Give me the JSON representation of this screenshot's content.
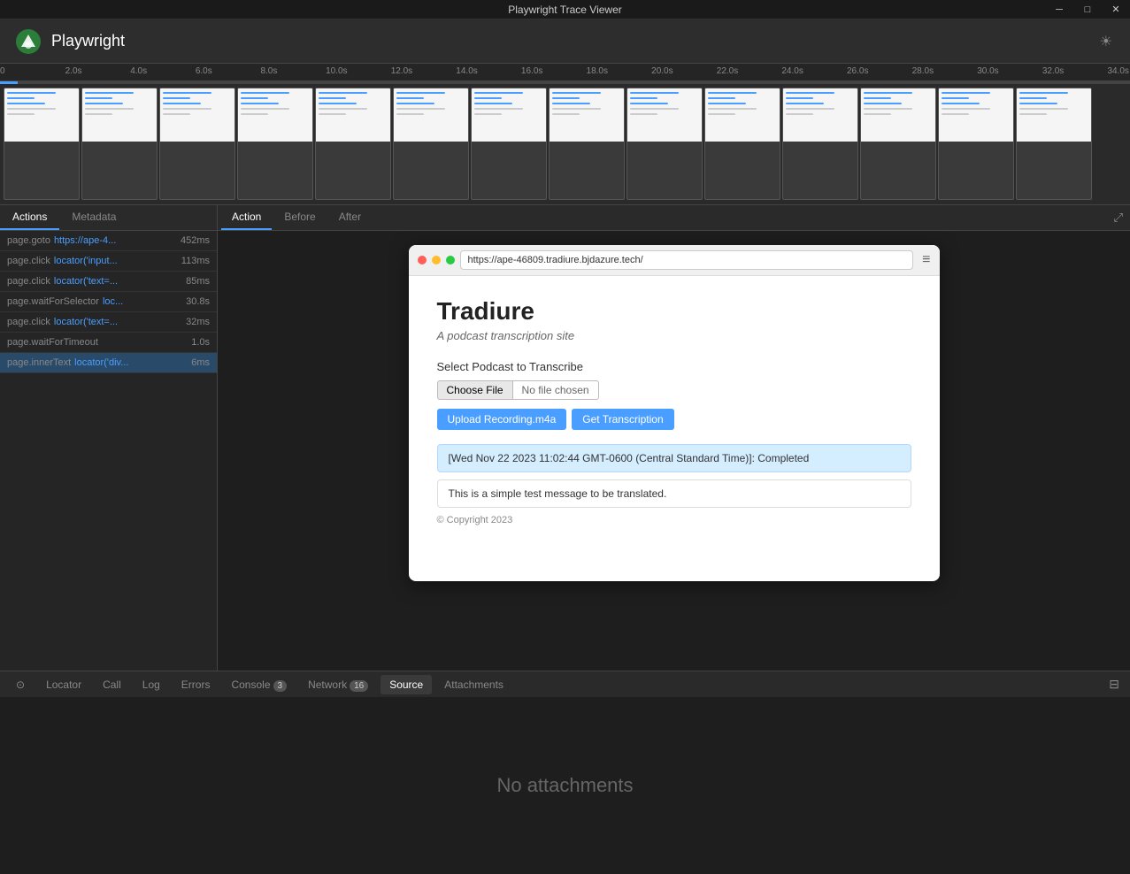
{
  "titleBar": {
    "title": "Playwright Trace Viewer",
    "controls": [
      "minimize",
      "maximize",
      "close"
    ]
  },
  "header": {
    "appTitle": "Playwright",
    "themeIcon": "☀"
  },
  "timeline": {
    "ticks": [
      "0",
      "2.0s",
      "4.0s",
      "6.0s",
      "8.0s",
      "10.0s",
      "12.0s",
      "14.0s",
      "16.0s",
      "18.0s",
      "20.0s",
      "22.0s",
      "24.0s",
      "26.0s",
      "28.0s",
      "30.0s",
      "32.0s",
      "34.0s"
    ]
  },
  "leftPanel": {
    "tabs": [
      {
        "label": "Actions",
        "active": true
      },
      {
        "label": "Metadata",
        "active": false
      }
    ],
    "actions": [
      {
        "method": "page.goto",
        "locator": "https://ape-4...",
        "duration": "452ms",
        "active": false
      },
      {
        "method": "page.click",
        "locator": "locator('input...",
        "duration": "113ms",
        "active": false
      },
      {
        "method": "page.click",
        "locator": "locator('text=...",
        "duration": "85ms",
        "active": false
      },
      {
        "method": "page.waitForSelector",
        "locator": "loc...",
        "duration": "30.8s",
        "active": false
      },
      {
        "method": "page.click",
        "locator": "locator('text=...",
        "duration": "32ms",
        "active": false
      },
      {
        "method": "page.waitForTimeout",
        "locator": "",
        "duration": "1.0s",
        "active": false
      },
      {
        "method": "page.innerText",
        "locator": "locator('div...",
        "duration": "6ms",
        "active": true
      }
    ]
  },
  "rightPanel": {
    "tabs": [
      {
        "label": "Action",
        "active": true
      },
      {
        "label": "Before",
        "active": false
      },
      {
        "label": "After",
        "active": false
      }
    ],
    "expandIcon": "⤢",
    "browser": {
      "url": "https://ape-46809.tradiure.bjdazure.tech/",
      "site": {
        "title": "Tradiure",
        "subtitle": "A podcast transcription site",
        "selectLabel": "Select Podcast to Transcribe",
        "chooseFileBtn": "Choose File",
        "noFileText": "No file chosen",
        "uploadBtn": "Upload Recording.m4a",
        "transcribeBtn": "Get Transcription",
        "statusMessage": "[Wed Nov 22 2023 11:02:44 GMT-0600 (Central Standard Time)]: Completed",
        "resultMessage": "This is a simple test message to be translated.",
        "copyright": "© Copyright 2023"
      }
    }
  },
  "bottomBar": {
    "tabs": [
      {
        "label": "⊙",
        "type": "icon",
        "active": false
      },
      {
        "label": "Locator",
        "active": false
      },
      {
        "label": "Call",
        "active": false
      },
      {
        "label": "Log",
        "active": false
      },
      {
        "label": "Errors",
        "active": false
      },
      {
        "label": "Console",
        "active": false,
        "badge": "3"
      },
      {
        "label": "Network",
        "active": false,
        "badge": "16"
      },
      {
        "label": "Source",
        "active": true
      },
      {
        "label": "Attachments",
        "active": false
      }
    ]
  },
  "attachments": {
    "emptyMessage": "No attachments"
  }
}
